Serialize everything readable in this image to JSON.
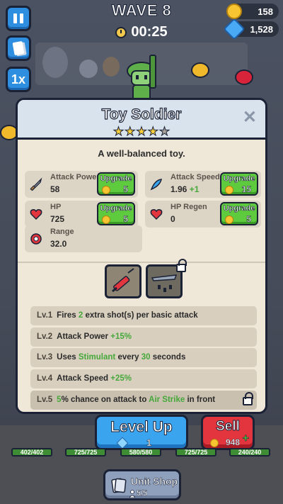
{
  "hud": {
    "wave": "WAVE 8",
    "timer": "00:25",
    "coins": "158",
    "gems": "1,528",
    "speed": "1x"
  },
  "unit": {
    "name": "Toy Soldier",
    "stars_filled": 4,
    "stars_total": 5,
    "description": "A well-balanced toy."
  },
  "stats": [
    {
      "label": "Attack Power",
      "value": "58",
      "bonus": "",
      "upgrade_label": "Upgrade",
      "upgrade_cost": "5",
      "icon": "sword-icon"
    },
    {
      "label": "Attack Speed",
      "value": "1.96",
      "bonus": "+1",
      "upgrade_label": "Upgrade",
      "upgrade_cost": "15",
      "icon": "speed-feather-icon"
    },
    {
      "label": "HP",
      "value": "725",
      "bonus": "",
      "upgrade_label": "Upgrade",
      "upgrade_cost": "5",
      "icon": "heart-icon"
    },
    {
      "label": "HP Regen",
      "value": "0",
      "bonus": "",
      "upgrade_label": "Upgrade",
      "upgrade_cost": "5",
      "icon": "heart-regen-icon"
    },
    {
      "label": "Range",
      "value": "32.0",
      "icon": "target-icon"
    }
  ],
  "items": [
    {
      "name": "stimulant-syringe-icon",
      "locked": false
    },
    {
      "name": "air-strike-plane-icon",
      "locked": true
    }
  ],
  "perks": [
    {
      "level": "Lv.1",
      "parts": [
        "Fires ",
        "2",
        " extra shot(s) per basic attack"
      ],
      "locked": false
    },
    {
      "level": "Lv.2",
      "parts": [
        "Attack Power ",
        "+15%",
        ""
      ],
      "locked": false
    },
    {
      "level": "Lv.3",
      "parts": [
        "Uses ",
        "Stimulant",
        " every ",
        "30",
        " seconds"
      ],
      "locked": false
    },
    {
      "level": "Lv.4",
      "parts": [
        "Attack Speed ",
        "+25%",
        ""
      ],
      "locked": false
    },
    {
      "level": "Lv.5",
      "parts": [
        "5",
        "% chance on attack to ",
        "Air Strike",
        " in front"
      ],
      "locked": true
    }
  ],
  "actions": {
    "level_up_label": "Level Up",
    "level_up_cost": "1",
    "sell_label": "Sell",
    "sell_value": "948"
  },
  "hp_bars": [
    "402/402",
    "725/725",
    "580/580",
    "725/725",
    "240/240"
  ],
  "unit_shop": {
    "label": "Unit Shop",
    "count": "5/5"
  },
  "colors": {
    "accent_blue": "#3aa4ef",
    "upgrade_green": "#5ecb3e",
    "sell_red": "#e3353d",
    "star_gold": "#ffd23c",
    "bonus_green": "#45a83a"
  }
}
